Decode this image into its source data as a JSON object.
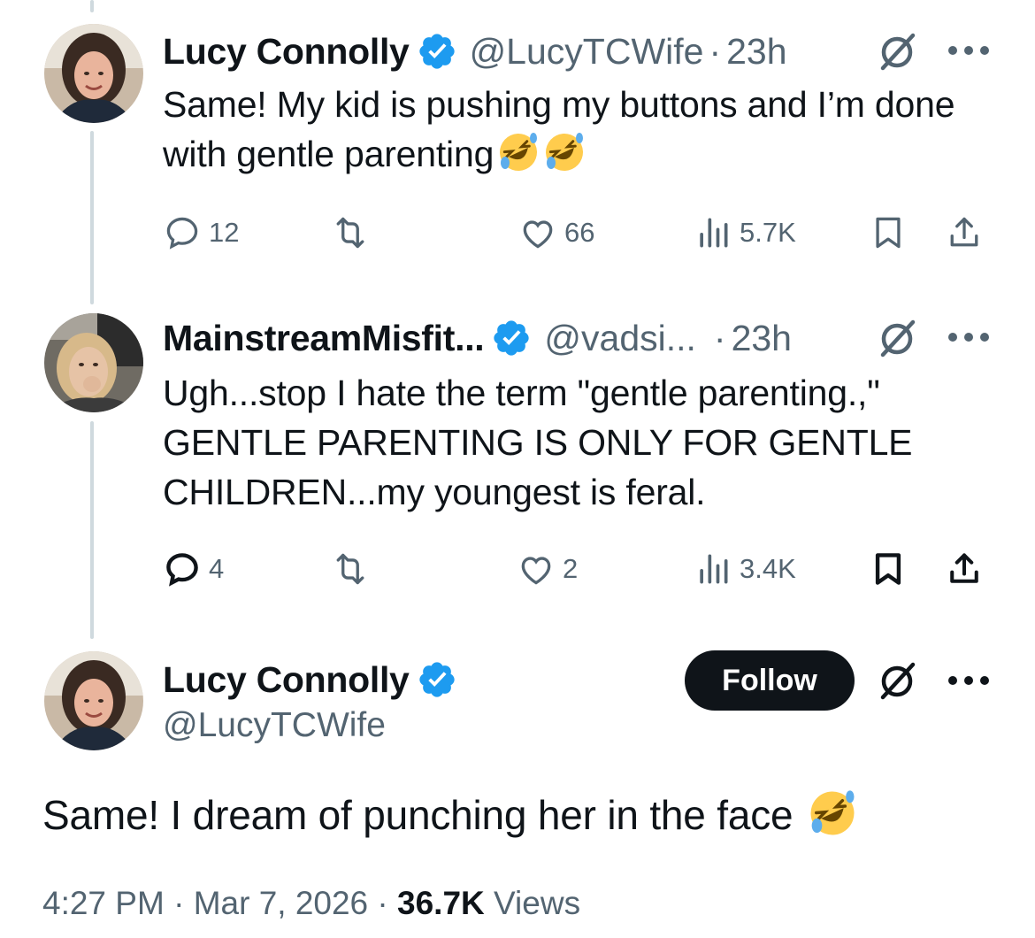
{
  "colors": {
    "text_primary": "#0f1419",
    "text_secondary": "#536471",
    "verified_blue": "#1d9bf0",
    "thread_line": "#cfd9de",
    "follow_bg": "#0f1419",
    "follow_text": "#ffffff"
  },
  "replies": [
    {
      "display_name": "Lucy Connolly",
      "verified": true,
      "handle": "@LucyTCWife",
      "dot": "·",
      "time": "23h",
      "text": "Same! My kid is pushing my buttons and I’m done with gentle parenting",
      "emojis": [
        "rolling-on-floor-laughing",
        "rolling-on-floor-laughing"
      ],
      "actions": {
        "reply_count": "12",
        "repost_count": "",
        "like_count": "66",
        "view_count": "5.7K"
      },
      "icons": [
        "reply-icon",
        "repost-icon",
        "like-icon",
        "views-icon",
        "bookmark-icon",
        "share-icon",
        "grok-icon",
        "more-icon"
      ]
    },
    {
      "display_name": "MainstreamMisfit...",
      "verified": true,
      "handle": "@vadsi...",
      "dot": "·",
      "time": "23h",
      "text_lines": [
        "Ugh...stop I hate the term \"gentle parenting.,\"",
        "GENTLE PARENTING IS ONLY FOR GENTLE",
        "CHILDREN...my youngest is feral."
      ],
      "actions": {
        "reply_count": "4",
        "repost_count": "",
        "like_count": "2",
        "view_count": "3.4K"
      }
    }
  ],
  "main_tweet": {
    "display_name": "Lucy Connolly",
    "verified": true,
    "handle": "@LucyTCWife",
    "follow_label": "Follow",
    "text": "Same! I dream of punching her in the face",
    "emoji": "rolling-on-floor-laughing",
    "time": "4:27 PM",
    "date": "Mar 7, 2026",
    "separator": "·",
    "views_count": "36.7K",
    "views_label": "Views"
  }
}
